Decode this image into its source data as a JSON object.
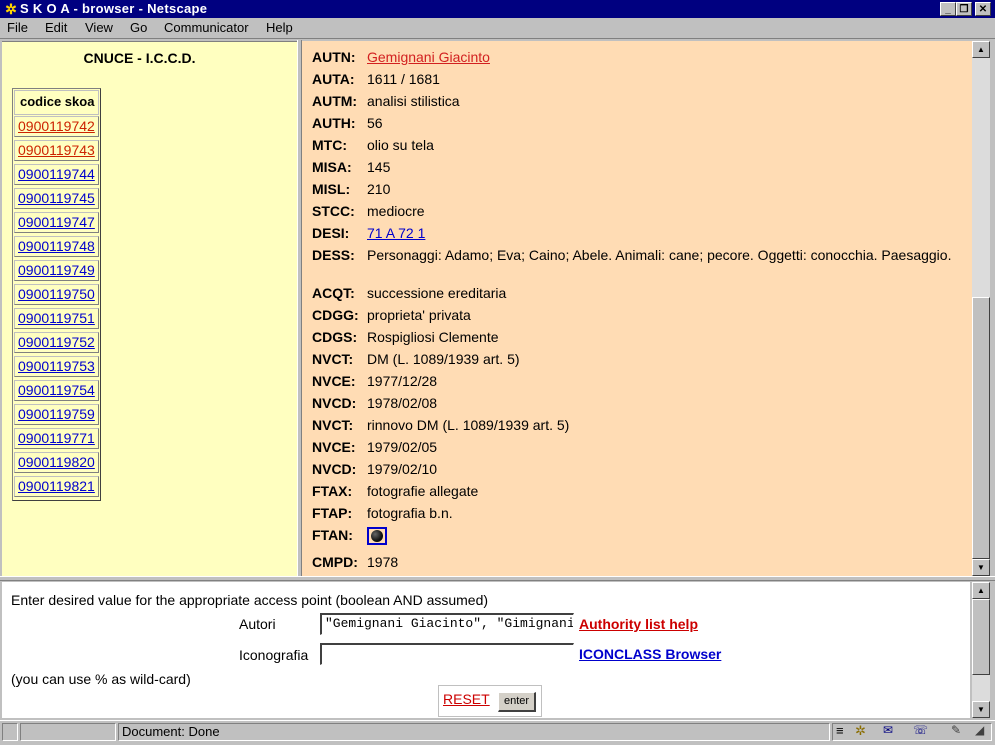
{
  "window": {
    "title": "S K O A - browser - Netscape",
    "controls": {
      "minimize": "_",
      "restore": "❐",
      "close": "✕"
    }
  },
  "menu": [
    "File",
    "Edit",
    "View",
    "Go",
    "Communicator",
    "Help"
  ],
  "left_frame": {
    "heading": "CNUCE - I.C.C.D.",
    "table_header": "codice skoa",
    "codes": [
      {
        "code": "0900119742",
        "visited": true
      },
      {
        "code": "0900119743",
        "visited": true
      },
      {
        "code": "0900119744",
        "visited": false
      },
      {
        "code": "0900119745",
        "visited": false
      },
      {
        "code": "0900119747",
        "visited": false
      },
      {
        "code": "0900119748",
        "visited": false
      },
      {
        "code": "0900119749",
        "visited": false
      },
      {
        "code": "0900119750",
        "visited": false
      },
      {
        "code": "0900119751",
        "visited": false
      },
      {
        "code": "0900119752",
        "visited": false
      },
      {
        "code": "0900119753",
        "visited": false
      },
      {
        "code": "0900119754",
        "visited": false
      },
      {
        "code": "0900119759",
        "visited": false
      },
      {
        "code": "0900119771",
        "visited": false
      },
      {
        "code": "0900119820",
        "visited": false
      },
      {
        "code": "0900119821",
        "visited": false
      }
    ]
  },
  "record": [
    {
      "label": "AUTN:",
      "value": "Gemignani  Giacinto   ",
      "link": "red"
    },
    {
      "label": "AUTA:",
      "value": "1611 / 1681"
    },
    {
      "label": "AUTM:",
      "value": "analisi stilistica"
    },
    {
      "label": "AUTH:",
      "value": "56"
    },
    {
      "label": "MTC:",
      "value": "olio su tela"
    },
    {
      "label": "MISA:",
      "value": "145"
    },
    {
      "label": "MISL:",
      "value": "210"
    },
    {
      "label": "STCC:",
      "value": "mediocre"
    },
    {
      "label": "DESI:",
      "value": "71 A 72 1 ",
      "link": "blue"
    },
    {
      "label": "DESS:",
      "value": "Personaggi: Adamo; Eva; Caino; Abele. Animali: cane; pecore. Oggetti: conocchia. Paesaggio."
    },
    {
      "label": "ACQT:",
      "value": "successione ereditaria"
    },
    {
      "label": "CDGG:",
      "value": "proprieta' privata"
    },
    {
      "label": "CDGS:",
      "value": "Rospigliosi Clemente"
    },
    {
      "label": "NVCT:",
      "value": "DM (L. 1089/1939 art. 5)"
    },
    {
      "label": "NVCE:",
      "value": "1977/12/28"
    },
    {
      "label": "NVCD:",
      "value": "1978/02/08"
    },
    {
      "label": "NVCT:",
      "value": "rinnovo DM (L. 1089/1939 art. 5)"
    },
    {
      "label": "NVCE:",
      "value": "1979/02/05"
    },
    {
      "label": "NVCD:",
      "value": "1979/02/10"
    },
    {
      "label": "FTAX:",
      "value": "fotografie allegate"
    },
    {
      "label": "FTAP:",
      "value": "fotografia b.n."
    },
    {
      "label": "FTAN:",
      "value": "",
      "icon": "photo-thumbnail-icon"
    },
    {
      "label": "CMPD:",
      "value": "1978"
    }
  ],
  "search_form": {
    "intro": "Enter desired value for the appropriate access point (boolean AND assumed)",
    "autori_label": "Autori",
    "autori_value": "\"Gemignani Giacinto\", \"Gimignani Giacinto\"",
    "authority_link": "Authority list help",
    "iconografia_label": "Iconografia",
    "iconografia_value": "",
    "iconclass_link": "ICONCLASS Browser",
    "wildcard_note": "(you can use % as wild-card)",
    "reset_label": "RESET",
    "enter_label": "enter"
  },
  "status": {
    "text": "Document: Done"
  }
}
